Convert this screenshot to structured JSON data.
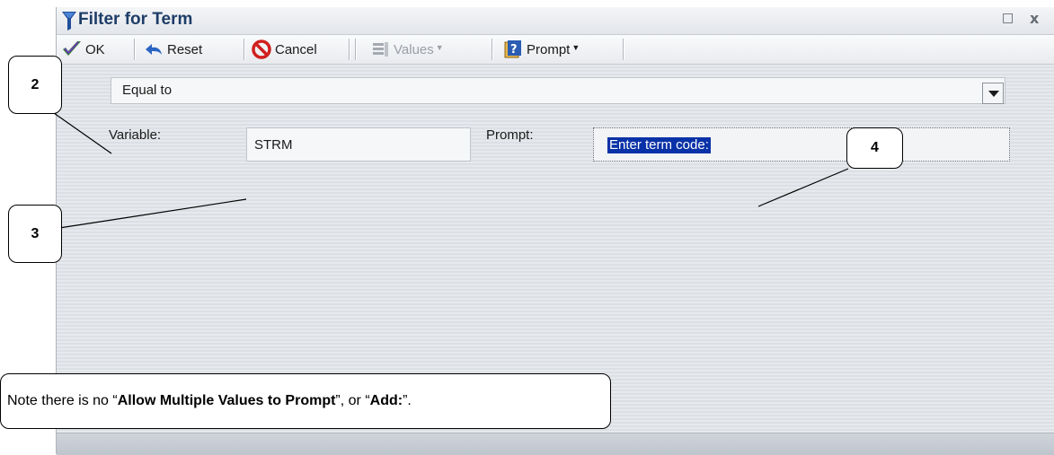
{
  "window": {
    "title": "Filter for Term",
    "maximize_glyph": "□",
    "close_glyph": "x"
  },
  "toolbar": {
    "ok_label": "OK",
    "reset_label": "Reset",
    "cancel_label": "Cancel",
    "values_label": "Values",
    "prompt_label": "Prompt"
  },
  "filter": {
    "operator": "Equal to",
    "variable_label": "Variable:",
    "variable_value": "STRM",
    "prompt_label": "Prompt:",
    "prompt_value": "Enter term code:"
  },
  "annotations": {
    "callout_2": "2",
    "callout_3": "3",
    "callout_4": "4",
    "note": {
      "prefix": "Note there is no “",
      "bold1": "Allow Multiple Values to Prompt",
      "middle": "”, or “",
      "bold2": "Add:",
      "suffix": "”."
    }
  },
  "colors": {
    "title_text": "#1e3d68",
    "selection_highlight": "#0a32a8",
    "panel_background": "#e1e4e9"
  },
  "icons": [
    "filter-icon",
    "check-icon",
    "reset-arrow-icon",
    "cancel-icon",
    "values-icon",
    "prompt-help-icon",
    "chevron-down-icon"
  ]
}
